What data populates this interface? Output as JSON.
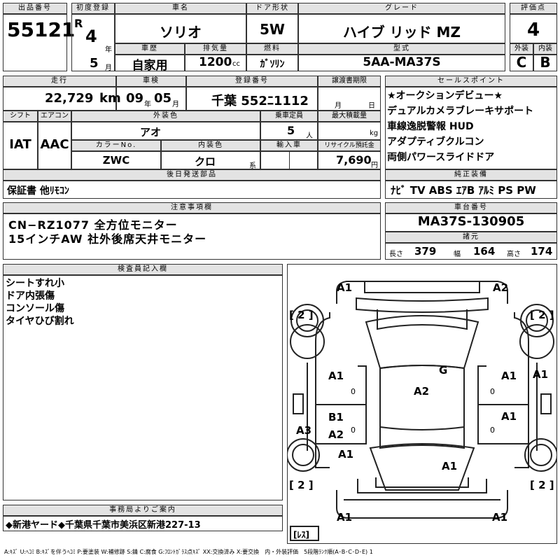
{
  "lot": {
    "label": "出品番号",
    "value": "55121"
  },
  "first_reg": {
    "label": "初度登録",
    "era": "R",
    "year": "4",
    "year_unit": "年",
    "month": "5",
    "month_unit": "月"
  },
  "car_name": {
    "label": "車名",
    "value": "ソリオ"
  },
  "door": {
    "label": "ドア形状",
    "value": "5W"
  },
  "grade": {
    "label": "グレード",
    "value": "ハイブ リッド MZ"
  },
  "score": {
    "label": "評価点",
    "value": "4",
    "ext_label": "外装",
    "int_label": "内装",
    "ext": "C",
    "int": "B"
  },
  "history": {
    "label": "車歴",
    "value": "自家用"
  },
  "displacement": {
    "label": "排気量",
    "value": "1200",
    "unit": "cc"
  },
  "fuel": {
    "label": "燃料",
    "value": "ｶﾞｿﾘﾝ"
  },
  "model": {
    "label": "型式",
    "value": "5AA-MA37S"
  },
  "mileage": {
    "label": "走行",
    "value": "22,729",
    "unit": "km"
  },
  "shaken": {
    "label": "車検",
    "year": "09",
    "year_unit": "年",
    "month": "05",
    "month_unit": "月"
  },
  "reg_no": {
    "label": "登録番号",
    "value": "千葉 552ﾆ1112"
  },
  "doc_deadline": {
    "label": "譲渡書期限",
    "month_unit": "月",
    "day_unit": "日"
  },
  "sales_points": {
    "label": "セールスポイント",
    "items": [
      "★オークションデビュー★",
      "デュアルカメラブレーキサポート",
      "車線逸脱警報 HUD",
      "アダプティブクルコン",
      "両側パワースライドドア"
    ]
  },
  "shift": {
    "label": "シフト",
    "value": "IAT"
  },
  "aircon": {
    "label": "エアコン",
    "value": "AAC"
  },
  "ext_color": {
    "label": "外装色",
    "value": "アオ"
  },
  "capacity": {
    "label": "乗車定員",
    "value": "5",
    "unit": "人"
  },
  "max_load": {
    "label": "最大積載量",
    "unit": "kg"
  },
  "color_no": {
    "label": "カラーNo.",
    "value": "ZWC"
  },
  "int_color": {
    "label": "内装色",
    "value": "クロ",
    "suffix": "系"
  },
  "import": {
    "label": "輸入車"
  },
  "recycle": {
    "label": "リサイクル預託金",
    "value": "7,690",
    "unit": "円"
  },
  "later_parts": {
    "label": "後日発送部品",
    "value": "保証書 他ﾘﾓｺﾝ"
  },
  "equipment": {
    "label": "純正装備",
    "value": "ﾅﾋﾞ TV ABS ｴｱB ｱﾙﾐ PS PW"
  },
  "notes": {
    "label": "注意事項欄",
    "lines": [
      "CN−RZ1077 全方位モニター",
      "15インチAW 社外後席天井モニター"
    ]
  },
  "chassis": {
    "label": "車台番号",
    "value": "MA37S-130905"
  },
  "specs": {
    "label": "諸元",
    "length_label": "長さ",
    "length": "379",
    "width_label": "幅",
    "width": "164",
    "height_label": "高さ",
    "height": "174"
  },
  "inspector": {
    "label": "検査員記入欄",
    "lines": [
      "シートすれ小",
      "ドア内張傷",
      "コンソール傷",
      "タイヤひび割れ"
    ]
  },
  "office": {
    "label": "事務局よりご案内",
    "value": "◆新港ヤード◆千葉県千葉市美浜区新港227-13"
  },
  "legend": "A:ｷｽﾞ U:ﾍｺﾐ B:ｷｽﾞを伴うﾍｺﾐ P:要塗装 W:補修跡 S:錆 C:腐食 G:ﾌﾛﾝﾄｶﾞﾗｽ点ｷｽﾞ XX:交換済み X:要交換　内・外装評価　5段階ﾗﾝｸ順(A･B･C･D･E) 1",
  "diagram": {
    "marks": {
      "front_left": "A1",
      "front_right": "A2",
      "left_front_door": "A1",
      "left_front_door_num": "0",
      "left_rear_door_top": "B1",
      "left_rear_door_bottom": "A2",
      "left_rear_door_num": "0",
      "left_quarter": "A3",
      "left_rear": "A1",
      "roof": "A2",
      "windshield": "G",
      "right_front_door": "A1",
      "right_front_door_num": "0",
      "right_fender": "A1",
      "right_rear_door": "A1",
      "right_rear_door_num": "0",
      "rear_hatch": "A1",
      "rear_left": "A1",
      "rear_right": "A1"
    },
    "tire_fl": "[ 2 ]",
    "tire_fr": "[ 2 ]",
    "tire_rl": "[ 2 ]",
    "tire_rr": "[ 2 ]",
    "spare": "[ﾚｽ]"
  }
}
